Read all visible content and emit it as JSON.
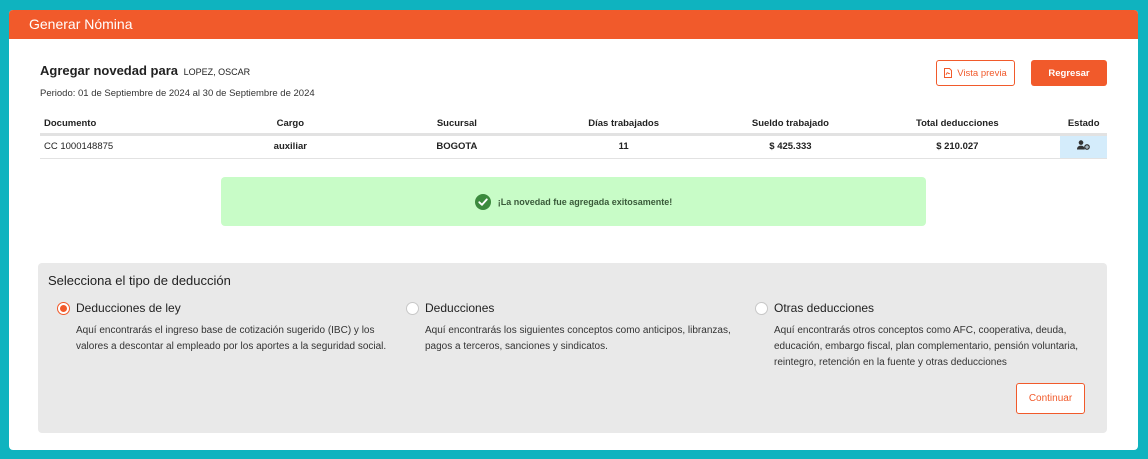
{
  "header": {
    "title": "Generar Nómina"
  },
  "novedad": {
    "title": "Agregar novedad para",
    "employee": "LOPEZ, OSCAR",
    "period": "Periodo: 01 de Septiembre de 2024 al 30 de Septiembre de 2024"
  },
  "actions": {
    "preview_label": "Vista previa",
    "back_label": "Regresar"
  },
  "table": {
    "headers": [
      "Documento",
      "Cargo",
      "Sucursal",
      "Días trabajados",
      "Sueldo trabajado",
      "Total deducciones",
      "Estado"
    ],
    "row": {
      "documento": "CC 1000148875",
      "cargo": "auxiliar",
      "sucursal": "BOGOTA",
      "dias": "11",
      "sueldo": "$ 425.333",
      "total": "$ 210.027",
      "estado_icon": "user-settings-icon"
    }
  },
  "alert": {
    "message": "¡La novedad fue agregada exitosamente!",
    "icon": "check-circle-icon",
    "color": "#c8fcc7"
  },
  "deduction_panel": {
    "title": "Selecciona el tipo de deducción",
    "options": [
      {
        "label": "Deducciones de ley",
        "selected": true,
        "description": "Aquí encontrarás el ingreso base de cotización sugerido (IBC) y los valores a descontar al empleado por los aportes a la seguridad social."
      },
      {
        "label": "Deducciones",
        "selected": false,
        "description": "Aquí encontrarás los siguientes conceptos como anticipos, libranzas, pagos a terceros, sanciones y sindicatos."
      },
      {
        "label": "Otras deducciones",
        "selected": false,
        "description": "Aquí encontrarás otros conceptos como AFC, cooperativa, deuda, educación, embargo fiscal, plan complementario, pensión voluntaria, reintegro, retención en la fuente y otras deducciones"
      }
    ],
    "continue_label": "Continuar"
  },
  "colors": {
    "accent": "#f15a2b",
    "background": "#0fb3bf",
    "panel": "#e9e9e9",
    "estado_cell": "#d4ecfb"
  }
}
